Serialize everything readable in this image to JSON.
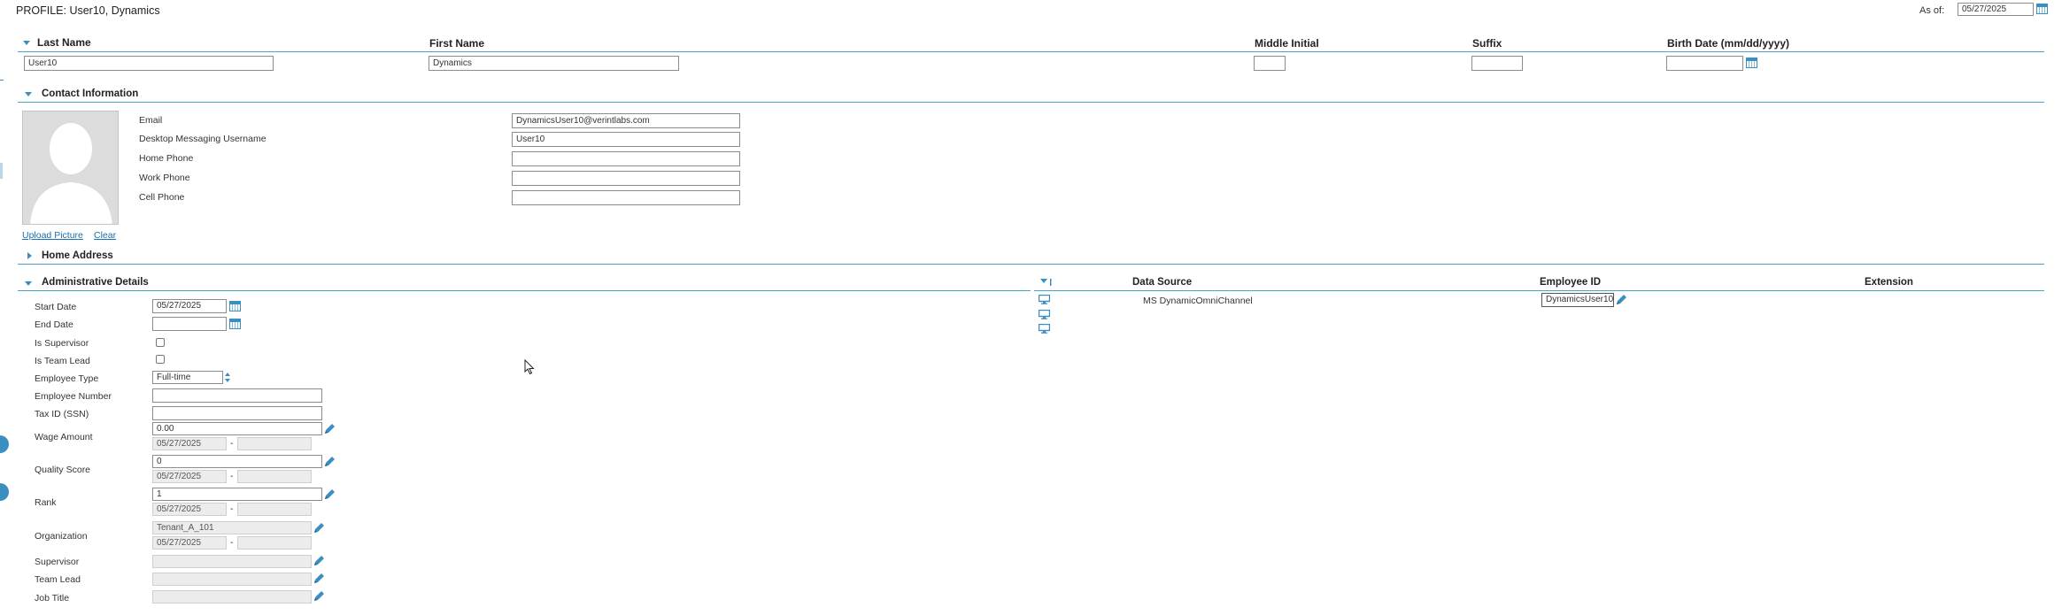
{
  "header": {
    "profile_label": "PROFILE:",
    "profile_name": "User10, Dynamics",
    "as_of_label": "As of:",
    "as_of_value": "05/27/2025"
  },
  "name_section": {
    "columns": [
      "Last Name",
      "First Name",
      "Middle Initial",
      "Suffix",
      "Birth Date (mm/dd/yyyy)"
    ],
    "last_name": "User10",
    "first_name": "Dynamics",
    "middle_initial": "",
    "suffix": "",
    "birth_date": ""
  },
  "contact": {
    "title": "Contact Information",
    "upload_label": "Upload Picture",
    "clear_label": "Clear",
    "fields": [
      {
        "label": "Email",
        "value": "DynamicsUser10@verintlabs.com"
      },
      {
        "label": "Desktop Messaging Username",
        "value": "User10"
      },
      {
        "label": "Home Phone",
        "value": ""
      },
      {
        "label": "Work Phone",
        "value": ""
      },
      {
        "label": "Cell Phone",
        "value": ""
      }
    ]
  },
  "home_address": {
    "title": "Home Address"
  },
  "admin": {
    "title": "Administrative Details",
    "start_date_label": "Start Date",
    "start_date": "05/27/2025",
    "end_date_label": "End Date",
    "end_date": "",
    "is_supervisor_label": "Is Supervisor",
    "is_team_lead_label": "Is Team Lead",
    "employee_type_label": "Employee Type",
    "employee_type": "Full-time",
    "employee_number_label": "Employee Number",
    "employee_number": "",
    "tax_id_label": "Tax ID (SSN)",
    "tax_id": "",
    "wage_label": "Wage Amount",
    "wage_value": "0.00",
    "wage_date": "05/27/2025",
    "quality_label": "Quality Score",
    "quality_value": "0",
    "quality_date": "05/27/2025",
    "rank_label": "Rank",
    "rank_value": "1",
    "rank_date": "05/27/2025",
    "org_label": "Organization",
    "org_value": "Tenant_A_101",
    "org_date": "05/27/2025",
    "supervisor_label": "Supervisor",
    "team_lead_label": "Team Lead",
    "job_title_label": "Job Title",
    "range_dash": "-"
  },
  "datasources": {
    "columns": [
      "Data Source",
      "Employee ID",
      "Extension"
    ],
    "rows": [
      {
        "source": "MS DynamicOmniChannel",
        "employee_id": "DynamicsUser10",
        "extension": ""
      }
    ]
  },
  "colors": {
    "accent": "#3a8fc0",
    "line": "#4aa3c8"
  }
}
